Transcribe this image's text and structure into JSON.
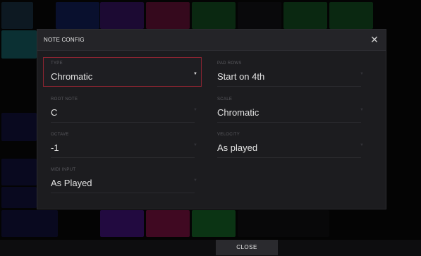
{
  "dialog": {
    "title": "NOTE CONFIG",
    "close_glyph": "✕"
  },
  "fields": {
    "type": {
      "label": "TYPE",
      "value": "Chromatic"
    },
    "pad_rows": {
      "label": "PAD ROWS",
      "value": "Start on 4th"
    },
    "root_note": {
      "label": "ROOT NOTE",
      "value": "C"
    },
    "scale": {
      "label": "SCALE",
      "value": "Chromatic"
    },
    "octave": {
      "label": "OCTAVE",
      "value": "-1"
    },
    "velocity": {
      "label": "VELOCITY",
      "value": "As played"
    },
    "midi_input": {
      "label": "MIDI INPUT",
      "value": "As Played"
    }
  },
  "bottom_bar": {
    "close_label": "CLOSE"
  },
  "icons": {
    "close": "close-icon",
    "dropdown": "caret-down-icon"
  },
  "colors": {
    "active_border": "#8c2431",
    "clip_green": "#1e8a3a",
    "clip_blue": "#2a4bd0",
    "clip_purple": "#6a25c8",
    "clip_magenta": "#c0206a",
    "clip_teal": "#2bb3b3"
  }
}
